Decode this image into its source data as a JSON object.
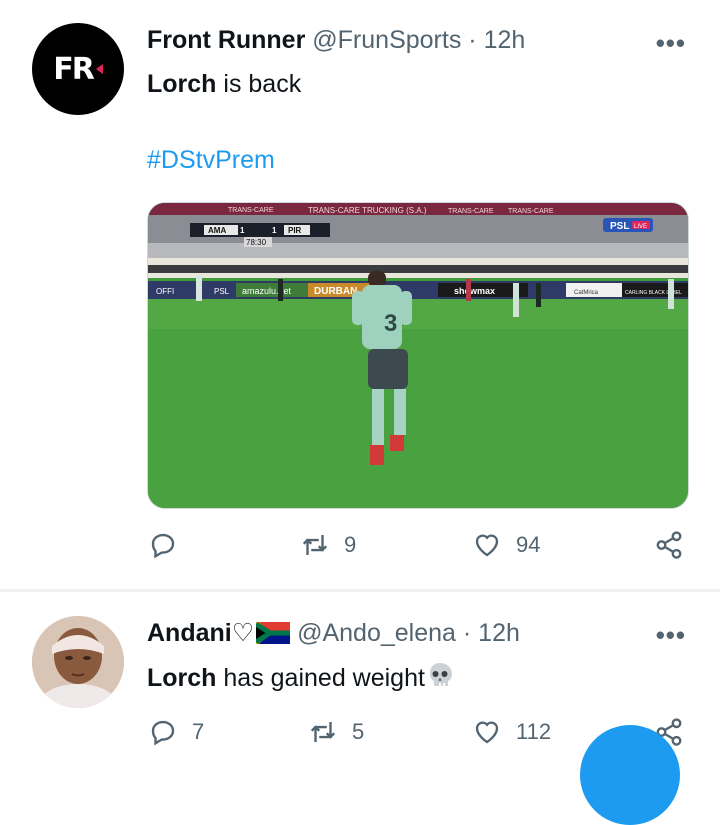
{
  "tweets": [
    {
      "author_name": "Front Runner",
      "handle": "@FrunSports",
      "separator": "·",
      "time": "12h",
      "avatar_text": "FR",
      "text_bold": "Lorch",
      "text_rest": " is back",
      "hashtag": "#DStvPrem",
      "media": {
        "scorebug": {
          "home": "AMA",
          "home_score": "1",
          "away_score": "1",
          "away": "PIR",
          "clock": "78:30"
        },
        "banner_top": [
          "TRANS-CARE",
          "TRANS-CARE TRUCKING (S.A.)",
          "TRANS-CARE",
          "TRANS-CARE"
        ],
        "badge": "PSL",
        "badge_live": "LIVE",
        "boards": [
          "OFFI",
          "PSL",
          "amazulu.net",
          "DURBAN",
          "showmax",
          "CatMrica",
          "CARLING BLACK LABEL"
        ],
        "player_number": "3"
      },
      "replies": "",
      "retweets": "9",
      "likes": "94"
    },
    {
      "author_name": "Andani♡",
      "handle": "@Ando_elena",
      "separator": "·",
      "time": "12h",
      "text_bold": "Lorch",
      "text_rest": " has gained weight",
      "replies": "7",
      "retweets": "5",
      "likes": "112"
    }
  ],
  "colors": {
    "accent": "#1d9bf0",
    "muted": "#536471",
    "text": "#0f1419"
  },
  "icons": [
    "more-icon",
    "reply-icon",
    "retweet-icon",
    "like-icon",
    "share-icon",
    "south-africa-flag-icon",
    "skull-icon"
  ]
}
